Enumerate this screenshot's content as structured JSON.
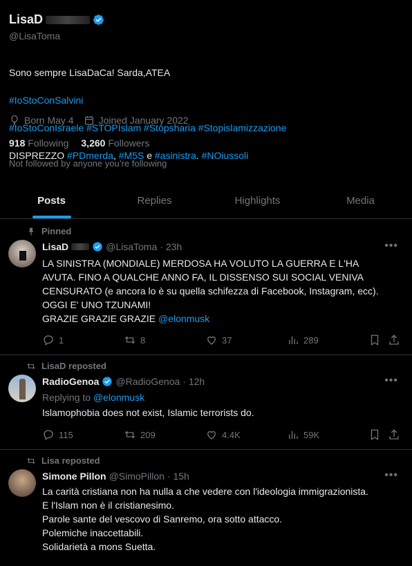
{
  "profile": {
    "name": "LisaD",
    "handle": "@LisaToma",
    "bio_line1": "Sono sempre LisaDaCa! Sarda,ATEA",
    "bio_tag1": "#IoStoConSalvini",
    "bio_tags2": "#IoStoConIsraele #STOPIslam #Stopsharia #Stopislamizzazione",
    "bio_disprezzo": "DISPREZZO",
    "bio_pd": "#PDmerda",
    "bio_m5s": "#M5S",
    "bio_e": "e",
    "bio_sinistra": "#asinistra",
    "bio_noius": "#NOiussoli",
    "born": "Born May 4",
    "joined": "Joined January 2022",
    "following_count": "918",
    "following_label": "Following",
    "followers_count": "3,260",
    "followers_label": "Followers",
    "not_followed": "Not followed by anyone you’re following"
  },
  "tabs": [
    "Posts",
    "Replies",
    "Highlights",
    "Media"
  ],
  "tweets": [
    {
      "context": "Pinned",
      "name": "LisaD",
      "handle": "@LisaToma",
      "time": "· 23h",
      "text": "LA SINISTRA (MONDIALE) MERDOSA HA VOLUTO LA GUERRA E L'HA AVUTA. FINO A QUALCHE ANNO FA, IL DISSENSO SUI SOCIAL VENIVA CENSURATO (e ancora lo è su quella schifezza di Facebook, Instagram, ecc). OGGI E' UNO TZUNAMI!\n GRAZIE GRAZIE GRAZIE ",
      "mention": "@elonmusk",
      "replies": "1",
      "retweets": "8",
      "likes": "37",
      "views": "289"
    },
    {
      "context": "LisaD reposted",
      "name": "RadioGenoa",
      "handle": "@RadioGenoa",
      "time": "· 12h",
      "replying_label": "Replying to",
      "replying_to": "@elonmusk",
      "text": "Islamophobia does not exist, Islamic terrorists do.",
      "replies": "115",
      "retweets": "209",
      "likes": "4.4K",
      "views": "59K"
    },
    {
      "context": "Lisa reposted",
      "name": "Simone Pillon",
      "handle": "@SimoPillon",
      "time": "· 15h",
      "text": "La carità cristiana non ha nulla a che vedere con l'ideologia immigrazionista.\nE l'Islam non è il cristianesimo.\nParole sante del vescovo di Sanremo, ora sotto attacco.\nPolemiche inaccettabili.\nSolidarietà a mons Suetta."
    }
  ],
  "colors": {
    "accent": "#1d9bf0",
    "muted": "#71767b",
    "text": "#e7e9ea",
    "border": "#2f3336"
  }
}
